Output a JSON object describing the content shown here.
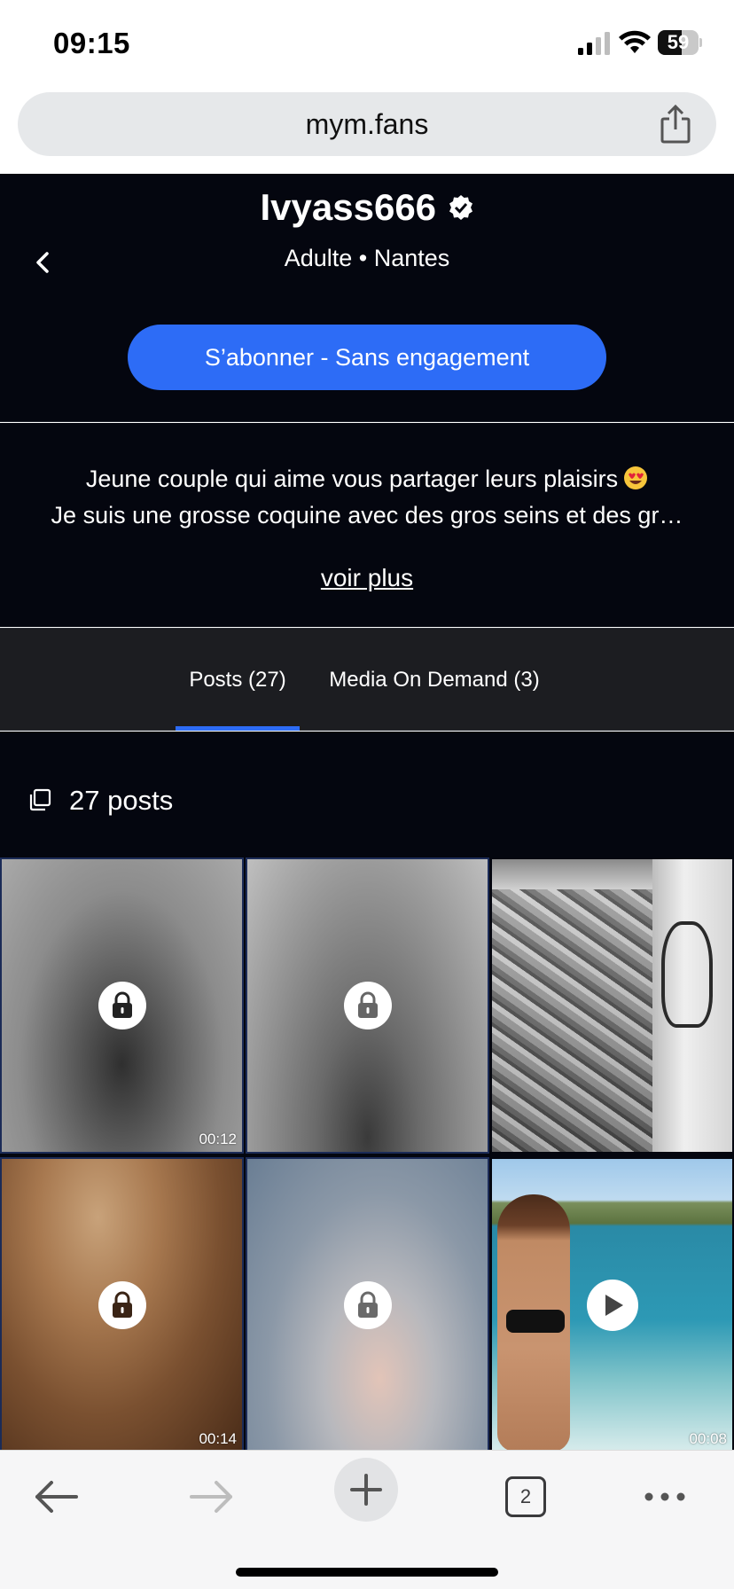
{
  "status": {
    "time": "09:15",
    "battery": "59",
    "battery_level": 59
  },
  "browser": {
    "url": "mym.fans",
    "tab_count": "2"
  },
  "profile": {
    "username": "Ivyass666",
    "subtitle": "Adulte • Nantes",
    "subscribe_label": "S’abonner - Sans engagement"
  },
  "bio": {
    "line1": "Jeune couple qui aime vous partager leurs plaisirs",
    "line1_emoji": "heart-eyes-emoji",
    "line2": "Je suis une grosse coquine avec des gros seins et des gr…",
    "more_label": "voir plus"
  },
  "tabs": [
    {
      "label": "Posts (27)",
      "active": true
    },
    {
      "label": "Media On Demand (3)",
      "active": false
    }
  ],
  "posts": {
    "count_label": "27 posts",
    "items": [
      {
        "type": "locked-video",
        "duration": "00:12",
        "icon": "lock-icon"
      },
      {
        "type": "locked-image",
        "duration": "",
        "icon": "lock-icon"
      },
      {
        "type": "image",
        "duration": "",
        "icon": ""
      },
      {
        "type": "locked-video",
        "duration": "00:14",
        "icon": "lock-icon"
      },
      {
        "type": "locked-image",
        "duration": "",
        "icon": "lock-icon"
      },
      {
        "type": "video",
        "duration": "00:08",
        "icon": "play-icon"
      }
    ]
  },
  "colors": {
    "accent": "#2d6cf6",
    "background_dark": "#04060f",
    "tab_bar": "#1c1d21"
  }
}
